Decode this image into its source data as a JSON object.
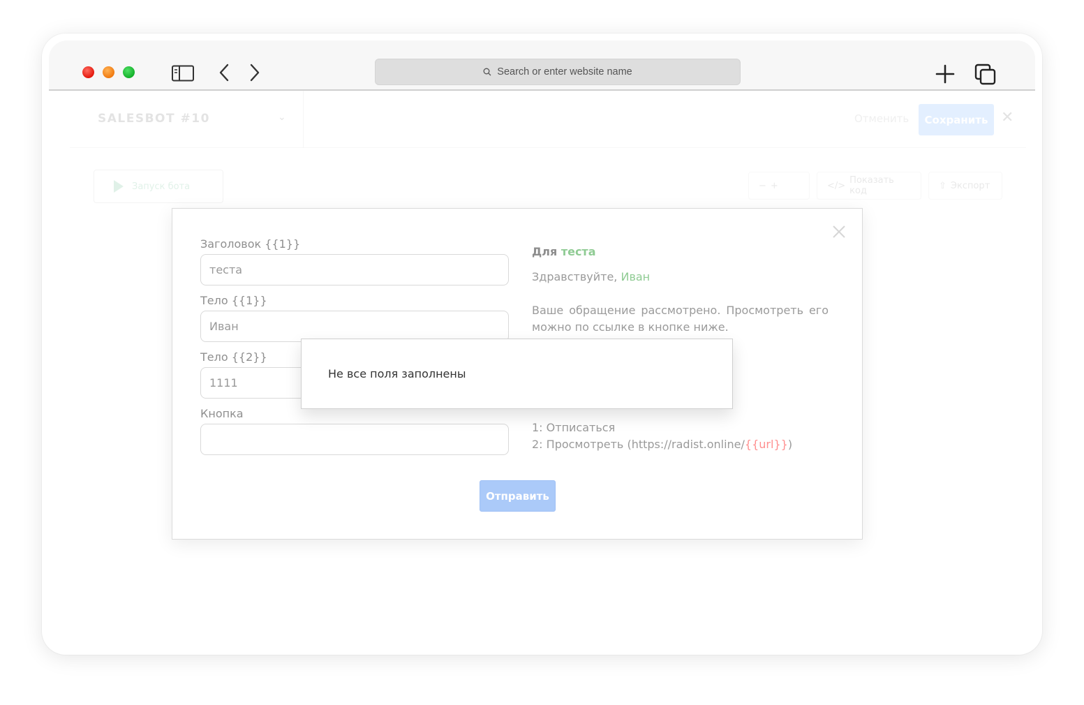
{
  "browser": {
    "address_placeholder": "Search or enter website name"
  },
  "app": {
    "bot_title": "SALESBOT #10",
    "cancel_label": "Отменить",
    "save_label": "Сохранить",
    "run_bot_label": "Запуск бота",
    "show_code_label": "Показать код",
    "export_label": "Экспорт"
  },
  "form": {
    "fields": [
      {
        "label": "Заголовок {{1}}",
        "value": "теста"
      },
      {
        "label": "Тело {{1}}",
        "value": "Иван"
      },
      {
        "label": "Тело {{2}}",
        "value": "1111"
      },
      {
        "label": "Кнопка",
        "value": ""
      }
    ],
    "submit_label": "Отправить"
  },
  "preview": {
    "title_prefix": "Для ",
    "title_var": "теста",
    "greeting_prefix": "Здравствуйте, ",
    "greeting_var": "Иван",
    "body": "Ваше обращение рассмотрено. Просмотреть его можно по ссылке в кнопке ниже.",
    "button_1": "1: Отписаться",
    "button_2_prefix": "2: Просмотреть (https://radist.online/",
    "button_2_var": "{{url}}",
    "button_2_suffix": ")"
  },
  "toast": {
    "message": "Не все поля заполнены"
  },
  "colors": {
    "accent": "#2d8cff",
    "variable_filled": "#8fcb93",
    "variable_missing": "#ff8f8f"
  }
}
